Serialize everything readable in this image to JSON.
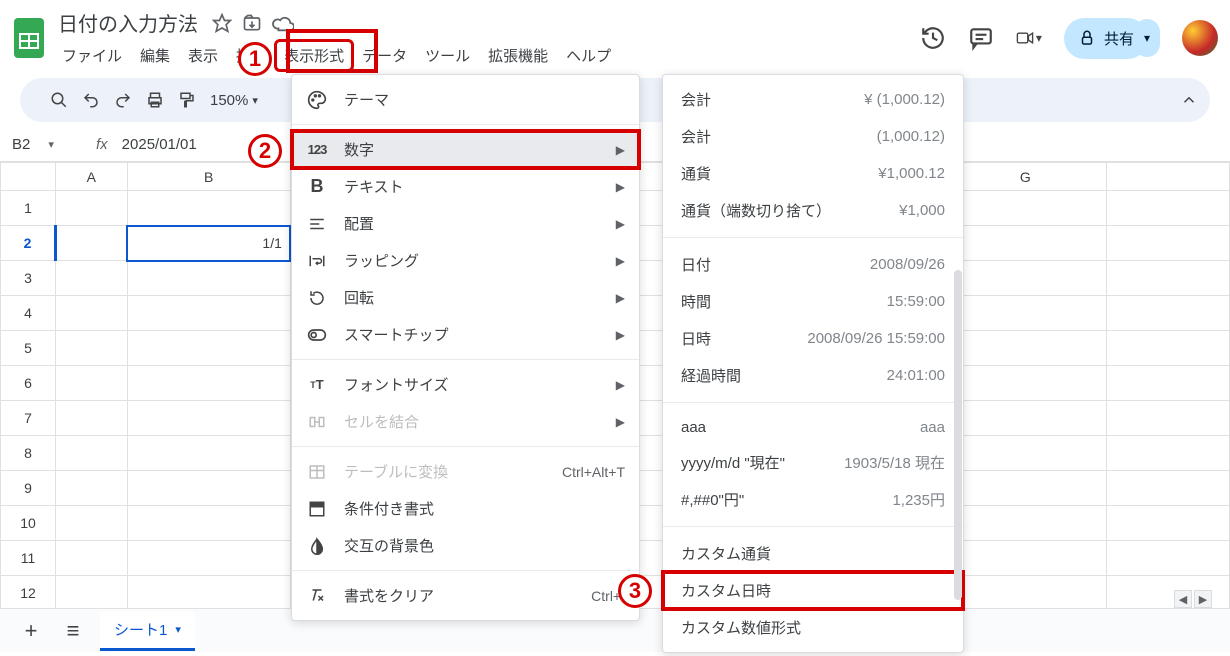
{
  "doc": {
    "title": "日付の入力方法"
  },
  "menubar": {
    "file": "ファイル",
    "edit": "編集",
    "view": "表示",
    "insert": "挿入",
    "format": "表示形式",
    "data": "データ",
    "tools": "ツール",
    "extensions": "拡張機能",
    "help": "ヘルプ"
  },
  "toolbar": {
    "zoom": "150%"
  },
  "share": {
    "label": "共有"
  },
  "formula": {
    "cell": "B2",
    "value": "2025/01/01"
  },
  "columns": [
    "A",
    "B",
    "",
    "",
    "",
    "",
    "G",
    ""
  ],
  "rows": [
    "1",
    "2",
    "3",
    "4",
    "5",
    "6",
    "7",
    "8",
    "9",
    "10",
    "11",
    "12"
  ],
  "selected_cell_display": "1/1",
  "format_menu": {
    "theme": "テーマ",
    "number": "数字",
    "text": "テキスト",
    "align": "配置",
    "wrap": "ラッピング",
    "rotate": "回転",
    "smartchip": "スマートチップ",
    "fontsize": "フォントサイズ",
    "merge": "セルを結合",
    "convert_table": "テーブルに変換",
    "convert_table_short": "Ctrl+Alt+T",
    "cond": "条件付き書式",
    "altcolor": "交互の背景色",
    "clear": "書式をクリア",
    "clear_short": "Ctrl+\\"
  },
  "number_menu": [
    {
      "label": "会計",
      "example": "¥ (1,000.12)"
    },
    {
      "label": "会計",
      "example": "(1,000.12)"
    },
    {
      "label": "通貨",
      "example": "¥1,000.12"
    },
    {
      "label": "通貨（端数切り捨て）",
      "example": "¥1,000"
    }
  ],
  "number_menu2": [
    {
      "label": "日付",
      "example": "2008/09/26"
    },
    {
      "label": "時間",
      "example": "15:59:00"
    },
    {
      "label": "日時",
      "example": "2008/09/26 15:59:00"
    },
    {
      "label": "経過時間",
      "example": "24:01:00"
    }
  ],
  "number_menu3": [
    {
      "label": "aaa",
      "example": "aaa"
    },
    {
      "label": "yyyy/m/d \"現在\"",
      "example": "1903/5/18 現在"
    },
    {
      "label": "#,##0\"円\"",
      "example": "1,235円"
    }
  ],
  "number_menu4": {
    "custom_currency": "カスタム通貨",
    "custom_datetime": "カスタム日時",
    "custom_number": "カスタム数値形式"
  },
  "sheet_tab": "シート1",
  "steps": {
    "s1": "1",
    "s2": "2",
    "s3": "3"
  }
}
